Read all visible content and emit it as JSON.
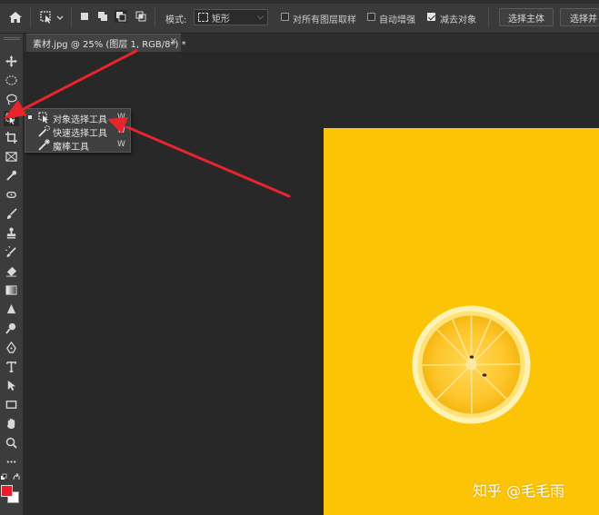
{
  "options_bar": {
    "mode_label": "模式:",
    "mode_value": "矩形",
    "sample_all_layers": {
      "label": "对所有图层取样",
      "checked": false
    },
    "auto_enhance": {
      "label": "自动增强",
      "checked": false
    },
    "subtract_object": {
      "label": "减去对象",
      "checked": true
    },
    "select_subject_label": "选择主体",
    "select_and_mask_label": "选择并"
  },
  "document_tab": {
    "title": "素材.jpg @ 25% (图层 1, RGB/8*) *",
    "close_glyph": "×"
  },
  "tool_flyout": {
    "items": [
      {
        "label": "对象选择工具",
        "shortcut": "W",
        "icon": "object-selection-icon",
        "selected": true
      },
      {
        "label": "快速选择工具",
        "shortcut": "W",
        "icon": "quick-selection-icon",
        "selected": false
      },
      {
        "label": "魔棒工具",
        "shortcut": "W",
        "icon": "magic-wand-icon",
        "selected": false
      }
    ]
  },
  "colors": {
    "foreground": "#ea1c2d",
    "background": "#ffffff",
    "image_yellow": "#fcc406",
    "annotation_arrow": "#e8242c"
  },
  "watermark": "知乎 @毛毛雨"
}
